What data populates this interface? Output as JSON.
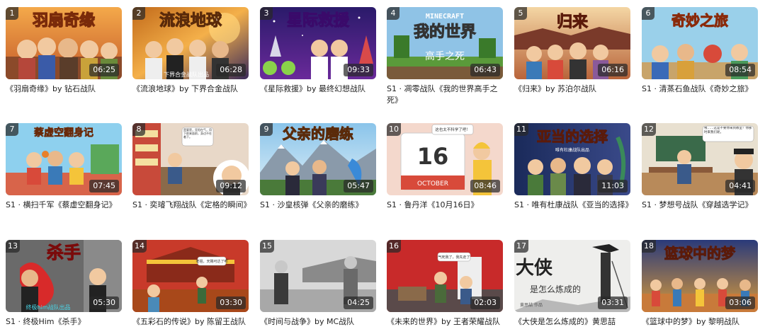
{
  "videos": [
    {
      "index": "1",
      "duration": "06:25",
      "caption": "《羽扇奇缘》by 钻石战队",
      "thumb_title": "羽扇奇缘",
      "thumb_subtitle": ""
    },
    {
      "index": "2",
      "duration": "06:28",
      "caption": "《流浪地球》by 下界合金战队",
      "thumb_title": "流浪地球",
      "thumb_subtitle": "下界合金战队出品"
    },
    {
      "index": "3",
      "duration": "09:33",
      "caption": "《星际救援》by 最终幻想战队",
      "thumb_title": "星际救援",
      "thumb_subtitle": ""
    },
    {
      "index": "4",
      "duration": "06:43",
      "caption": "S1 · 凋零战队《我的世界高手之死》",
      "thumb_title": "我的世界",
      "thumb_subtitle": "高手之死",
      "thumb_logo": "MINECRAFT"
    },
    {
      "index": "5",
      "duration": "06:16",
      "caption": "《归来》by 苏泊尔战队",
      "thumb_title": "归来",
      "thumb_subtitle": ""
    },
    {
      "index": "6",
      "duration": "08:54",
      "caption": "S1 · 清蒸石鱼战队《奇妙之旅》",
      "thumb_title": "奇妙之旅",
      "thumb_subtitle": ""
    },
    {
      "index": "7",
      "duration": "07:45",
      "caption": "S1 · 横扫千军《蔡虚空翻身记》",
      "thumb_title": "蔡虚空翻身记",
      "thumb_subtitle": ""
    },
    {
      "index": "8",
      "duration": "09:12",
      "caption": "S1 · 奕璿飞翔战队《定格的瞬间》",
      "thumb_title": "",
      "thumb_subtitle": "",
      "bubble": "是要是，亚阳在气，用下前来面前，身边不在着下。"
    },
    {
      "index": "9",
      "duration": "05:47",
      "caption": "S1 · 沙皇核弹《父亲的磨练》",
      "thumb_title": "父亲的磨练",
      "thumb_subtitle": ""
    },
    {
      "index": "10",
      "duration": "08:46",
      "caption": "S1 · 鲁丹洋《10月16日》",
      "thumb_title": "16",
      "thumb_subtitle": "OCTOBER",
      "bubble": "这也太不科学了吧！"
    },
    {
      "index": "11",
      "duration": "11:03",
      "caption": "S1 · 唯有杜康战队《亚当的选择》",
      "thumb_title": "亚当的选择",
      "thumb_subtitle": "唯有杜康战队出品"
    },
    {
      "index": "12",
      "duration": "04:41",
      "caption": "S1 · 梦想号战队《穿越选学记》",
      "thumb_title": "",
      "thumb_subtitle": "",
      "bubble": "咦……这是不要你来到教室！你那时来我们呢，"
    },
    {
      "index": "13",
      "duration": "05:30",
      "caption": "S1 · 终极Him《杀手》",
      "thumb_title": "杀手",
      "thumb_subtitle": "终极him战队出品"
    },
    {
      "index": "14",
      "duration": "03:30",
      "caption": "《五彩石的传说》by 陈留王战队",
      "thumb_title": "",
      "thumb_subtitle": "",
      "bubble": "老祖，天赐可达了吧"
    },
    {
      "index": "15",
      "duration": "04:25",
      "caption": "《时间与战争》by MC战队",
      "thumb_title": "",
      "thumb_subtitle": ""
    },
    {
      "index": "16",
      "duration": "02:03",
      "caption": "《未来的世界》by 王者荣耀战队",
      "thumb_title": "",
      "thumb_subtitle": "",
      "bubble": "气死我了，我先走了"
    },
    {
      "index": "17",
      "duration": "03:31",
      "caption": "《大侠是怎么炼成的》黄思喆",
      "thumb_title": "大侠",
      "thumb_subtitle": "是怎么炼成的",
      "thumb_author": "黄思喆 作品"
    },
    {
      "index": "18",
      "duration": "03:06",
      "caption": "《篮球中的梦》by 黎明战队",
      "thumb_title": "篮球中的梦",
      "thumb_subtitle": ""
    }
  ],
  "colors": {
    "badge_bg": "#2f2f2f",
    "caption_text": "#222222",
    "background": "#ffffff"
  }
}
